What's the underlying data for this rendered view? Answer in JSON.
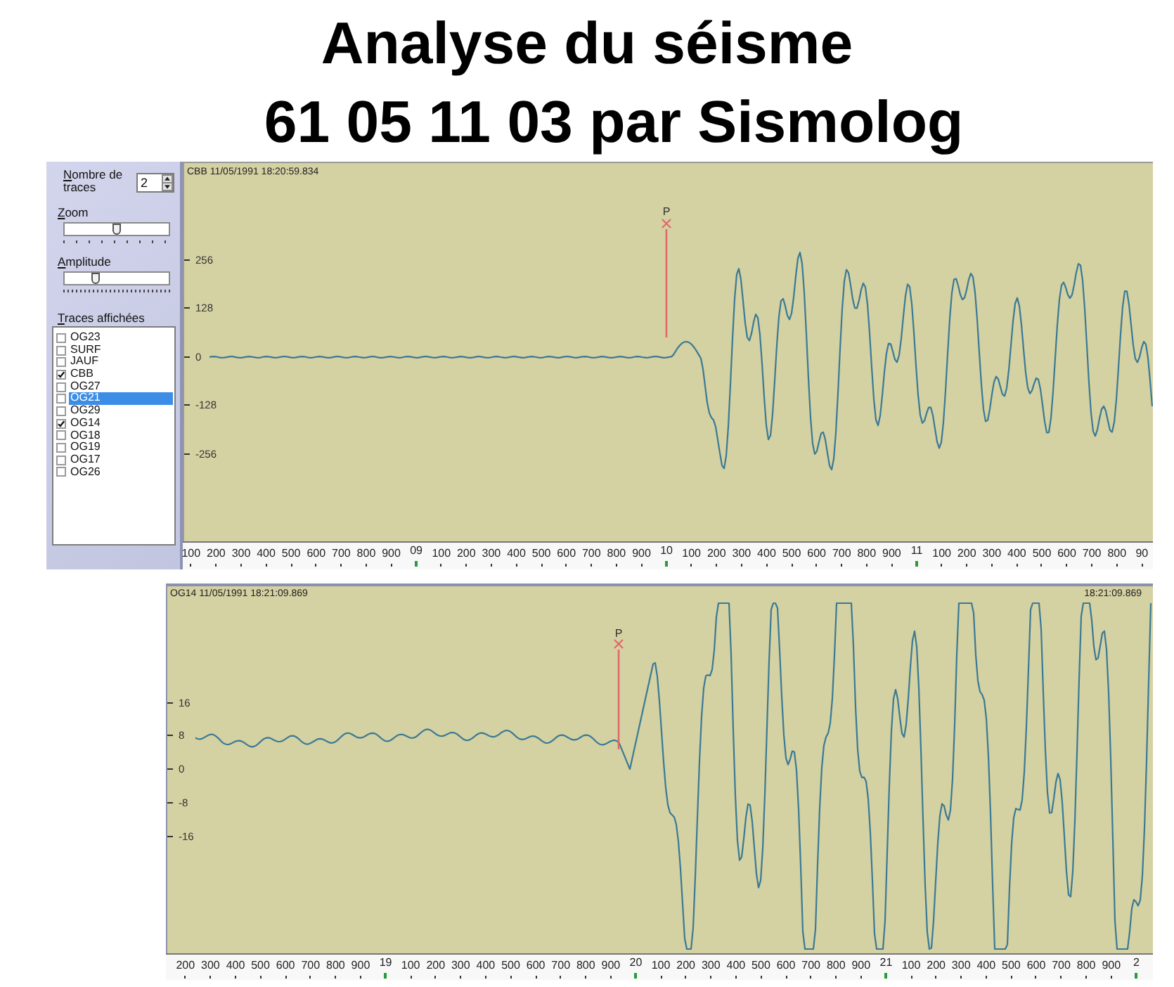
{
  "title_lines": [
    "Analyse du séisme",
    "61 05 11 03 par Sismolog"
  ],
  "main_view": {
    "panel": {
      "count": {
        "label": "Nombre de traces",
        "value": "2"
      },
      "zoom": {
        "label": "Zoom",
        "level": 0.5
      },
      "amplitude": {
        "label": "Amplitude",
        "level": 0.28
      },
      "traces_label": "Traces affichées",
      "traces": [
        {
          "name": "OG23",
          "checked": false,
          "selected": false
        },
        {
          "name": "SURF",
          "checked": false,
          "selected": false
        },
        {
          "name": "JAUF",
          "checked": false,
          "selected": false
        },
        {
          "name": "CBB",
          "checked": true,
          "selected": false
        },
        {
          "name": "OG27",
          "checked": false,
          "selected": false
        },
        {
          "name": "OG21",
          "checked": false,
          "selected": true
        },
        {
          "name": "OG29",
          "checked": false,
          "selected": false
        },
        {
          "name": "OG14",
          "checked": true,
          "selected": false
        },
        {
          "name": "OG18",
          "checked": false,
          "selected": false
        },
        {
          "name": "OG19",
          "checked": false,
          "selected": false
        },
        {
          "name": "OG17",
          "checked": false,
          "selected": false
        },
        {
          "name": "OG26",
          "checked": false,
          "selected": false
        }
      ]
    },
    "plot": {
      "header": "CBB 11/05/1991 18:20:59.834",
      "pick_label": "P",
      "y_ticks": [
        "256",
        "128",
        "0",
        "-128",
        "-256"
      ],
      "x_ticks": [
        {
          "label": "100",
          "kind": "minor"
        },
        {
          "label": "200",
          "kind": "minor"
        },
        {
          "label": "300",
          "kind": "minor"
        },
        {
          "label": "400",
          "kind": "minor"
        },
        {
          "label": "500",
          "kind": "minor"
        },
        {
          "label": "600",
          "kind": "minor"
        },
        {
          "label": "700",
          "kind": "minor"
        },
        {
          "label": "800",
          "kind": "minor"
        },
        {
          "label": "900",
          "kind": "minor"
        },
        {
          "label": "09",
          "kind": "major"
        },
        {
          "label": "100",
          "kind": "minor"
        },
        {
          "label": "200",
          "kind": "minor"
        },
        {
          "label": "300",
          "kind": "minor"
        },
        {
          "label": "400",
          "kind": "minor"
        },
        {
          "label": "500",
          "kind": "minor"
        },
        {
          "label": "600",
          "kind": "minor"
        },
        {
          "label": "700",
          "kind": "minor"
        },
        {
          "label": "800",
          "kind": "minor"
        },
        {
          "label": "900",
          "kind": "minor"
        },
        {
          "label": "10",
          "kind": "major"
        },
        {
          "label": "100",
          "kind": "minor"
        },
        {
          "label": "200",
          "kind": "minor"
        },
        {
          "label": "300",
          "kind": "minor"
        },
        {
          "label": "400",
          "kind": "minor"
        },
        {
          "label": "500",
          "kind": "minor"
        },
        {
          "label": "600",
          "kind": "minor"
        },
        {
          "label": "700",
          "kind": "minor"
        },
        {
          "label": "800",
          "kind": "minor"
        },
        {
          "label": "900",
          "kind": "minor"
        },
        {
          "label": "11",
          "kind": "major"
        },
        {
          "label": "100",
          "kind": "minor"
        },
        {
          "label": "200",
          "kind": "minor"
        },
        {
          "label": "300",
          "kind": "minor"
        },
        {
          "label": "400",
          "kind": "minor"
        },
        {
          "label": "500",
          "kind": "minor"
        },
        {
          "label": "600",
          "kind": "minor"
        },
        {
          "label": "700",
          "kind": "minor"
        },
        {
          "label": "800",
          "kind": "minor"
        },
        {
          "label": "90",
          "kind": "minor"
        }
      ]
    }
  },
  "second_view": {
    "plot": {
      "header": "OG14 11/05/1991 18:21:09.869",
      "header_right": "18:21:09.869",
      "pick_label": "P",
      "y_ticks": [
        "16",
        "8",
        "0",
        "-8",
        "-16"
      ],
      "x_ticks": [
        {
          "label": "200",
          "kind": "minor"
        },
        {
          "label": "300",
          "kind": "minor"
        },
        {
          "label": "400",
          "kind": "minor"
        },
        {
          "label": "500",
          "kind": "minor"
        },
        {
          "label": "600",
          "kind": "minor"
        },
        {
          "label": "700",
          "kind": "minor"
        },
        {
          "label": "800",
          "kind": "minor"
        },
        {
          "label": "900",
          "kind": "minor"
        },
        {
          "label": "19",
          "kind": "major"
        },
        {
          "label": "100",
          "kind": "minor"
        },
        {
          "label": "200",
          "kind": "minor"
        },
        {
          "label": "300",
          "kind": "minor"
        },
        {
          "label": "400",
          "kind": "minor"
        },
        {
          "label": "500",
          "kind": "minor"
        },
        {
          "label": "600",
          "kind": "minor"
        },
        {
          "label": "700",
          "kind": "minor"
        },
        {
          "label": "800",
          "kind": "minor"
        },
        {
          "label": "900",
          "kind": "minor"
        },
        {
          "label": "20",
          "kind": "major"
        },
        {
          "label": "100",
          "kind": "minor"
        },
        {
          "label": "200",
          "kind": "minor"
        },
        {
          "label": "300",
          "kind": "minor"
        },
        {
          "label": "400",
          "kind": "minor"
        },
        {
          "label": "500",
          "kind": "minor"
        },
        {
          "label": "600",
          "kind": "minor"
        },
        {
          "label": "700",
          "kind": "minor"
        },
        {
          "label": "800",
          "kind": "minor"
        },
        {
          "label": "900",
          "kind": "minor"
        },
        {
          "label": "21",
          "kind": "major"
        },
        {
          "label": "100",
          "kind": "minor"
        },
        {
          "label": "200",
          "kind": "minor"
        },
        {
          "label": "300",
          "kind": "minor"
        },
        {
          "label": "400",
          "kind": "minor"
        },
        {
          "label": "500",
          "kind": "minor"
        },
        {
          "label": "600",
          "kind": "minor"
        },
        {
          "label": "700",
          "kind": "minor"
        },
        {
          "label": "800",
          "kind": "minor"
        },
        {
          "label": "900",
          "kind": "minor"
        },
        {
          "label": "2",
          "kind": "major"
        }
      ]
    }
  }
}
